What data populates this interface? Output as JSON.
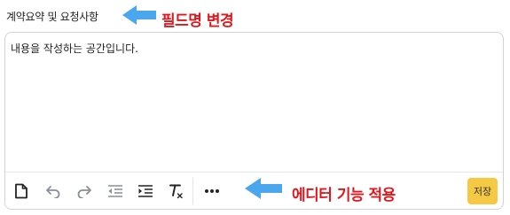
{
  "field": {
    "label": "계약요약 및 요청사항"
  },
  "annotations": {
    "field_rename": "필드명 변경",
    "editor_feature": "에디터 기능 적용"
  },
  "editor": {
    "content": "내용을 작성하는 공간입니다."
  },
  "toolbar": {
    "icons": [
      "new-document-icon",
      "undo-icon",
      "redo-icon",
      "outdent-icon",
      "indent-icon",
      "clear-format-icon",
      "more-icon"
    ],
    "save_label": "저장"
  },
  "colors": {
    "annotation_red": "#e3161b",
    "arrow_blue": "#4aa7ee",
    "save_button_bg": "#f6c945"
  }
}
